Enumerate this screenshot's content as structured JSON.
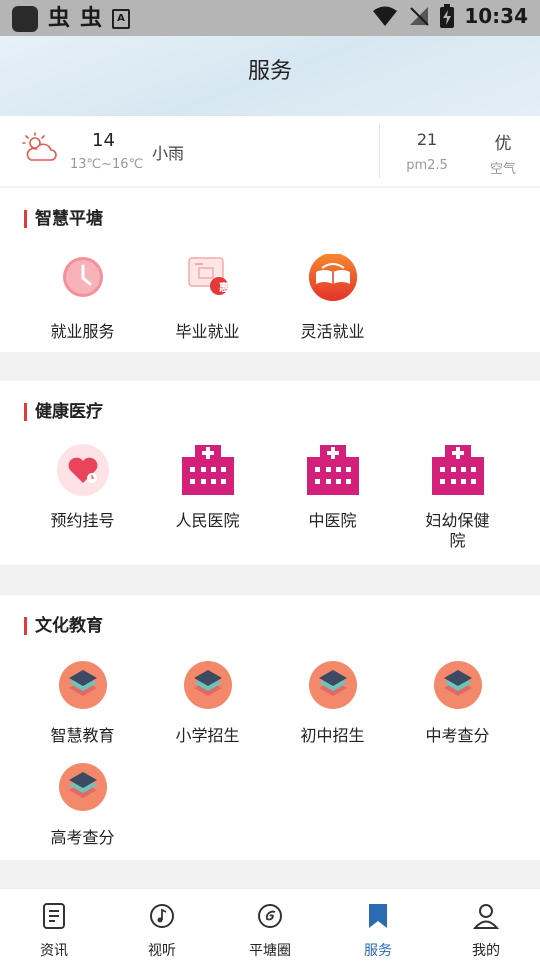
{
  "status_bar": {
    "time": "10:34",
    "glyph": "虫",
    "a_icon": "A"
  },
  "header": {
    "title": "服务"
  },
  "weather": {
    "icon": "sun-cloud-icon",
    "temperature": "14",
    "range": "13℃~16℃",
    "condition": "小雨",
    "pm_value": "21",
    "pm_label": "pm2.5",
    "air_value": "优",
    "air_label": "空气"
  },
  "sections": [
    {
      "title": "智慧平塘",
      "items": [
        {
          "label": "就业服务",
          "icon": "clock-icon"
        },
        {
          "label": "毕业就业",
          "icon": "coupon-icon",
          "badge": "惠"
        },
        {
          "label": "灵活就业",
          "icon": "book-icon"
        }
      ]
    },
    {
      "title": "健康医疗",
      "items": [
        {
          "label": "预约挂号",
          "icon": "heart-appointment-icon"
        },
        {
          "label": "人民医院",
          "icon": "hospital-icon"
        },
        {
          "label": "中医院",
          "icon": "hospital-icon"
        },
        {
          "label": "妇幼保健院",
          "icon": "hospital-icon"
        }
      ]
    },
    {
      "title": "文化教育",
      "items": [
        {
          "label": "智慧教育",
          "icon": "layers-icon"
        },
        {
          "label": "小学招生",
          "icon": "layers-icon"
        },
        {
          "label": "初中招生",
          "icon": "layers-icon"
        },
        {
          "label": "中考查分",
          "icon": "layers-icon"
        },
        {
          "label": "高考查分",
          "icon": "layers-icon"
        }
      ]
    }
  ],
  "nav": [
    {
      "label": "资讯",
      "icon": "news-icon"
    },
    {
      "label": "视听",
      "icon": "music-note-icon"
    },
    {
      "label": "平塘圈",
      "icon": "spiral-icon"
    },
    {
      "label": "服务",
      "icon": "bookmark-icon",
      "active": true
    },
    {
      "label": "我的",
      "icon": "user-icon"
    }
  ],
  "colors": {
    "accent_red": "#e23a3a",
    "nav_active": "#2a6bb3",
    "hospital_magenta": "#d3207a",
    "layers_orange": "#f3896a"
  }
}
